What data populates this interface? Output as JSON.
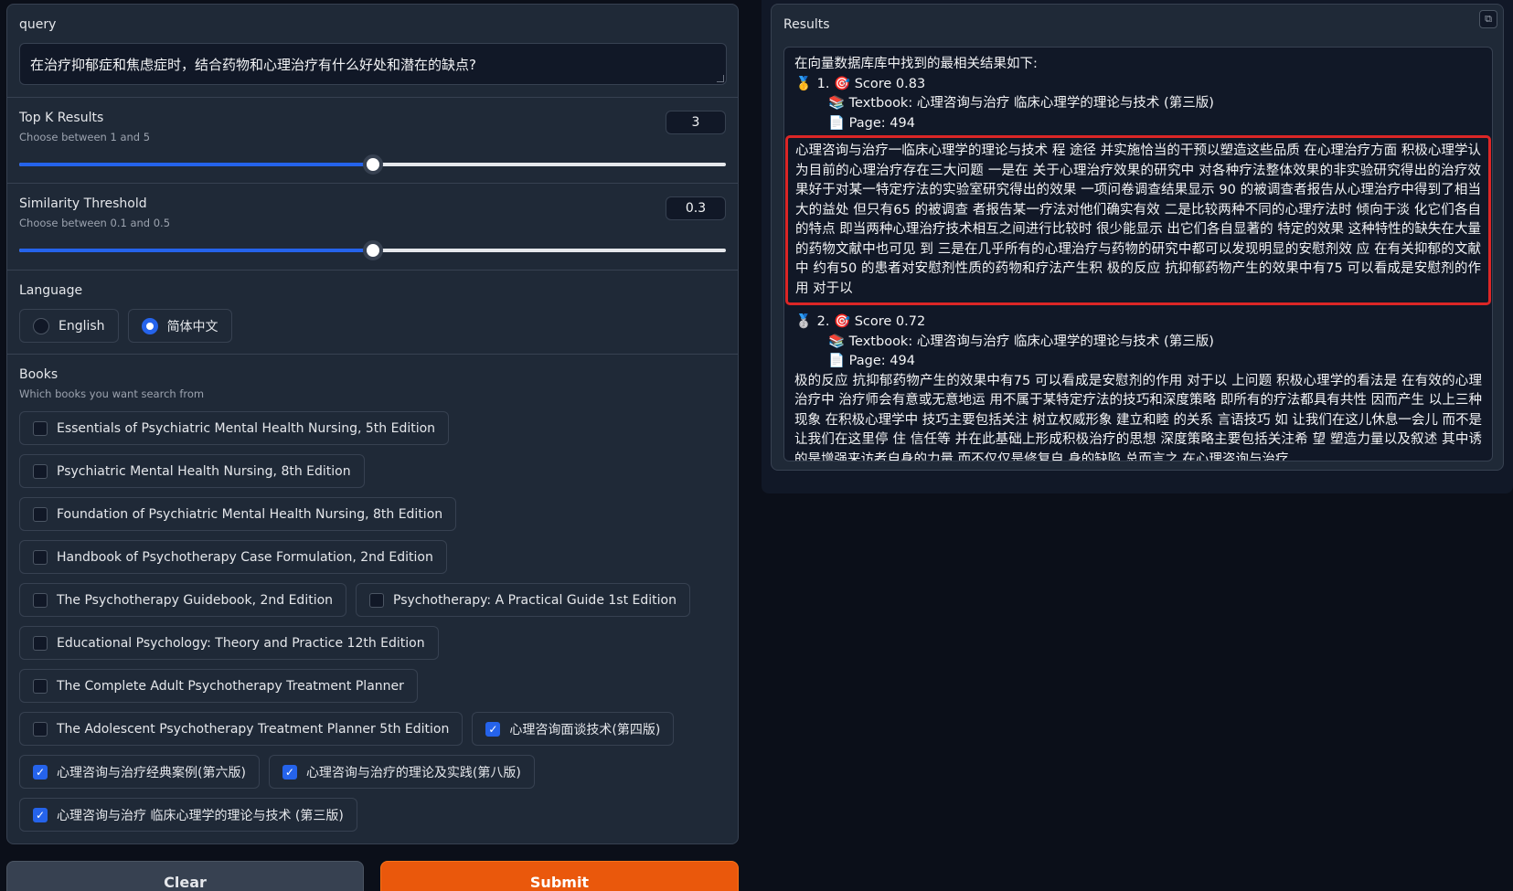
{
  "query": {
    "label": "query",
    "value": "在治疗抑郁症和焦虑症时，结合药物和心理治疗有什么好处和潜在的缺点?"
  },
  "top_k": {
    "label": "Top K Results",
    "info": "Choose between 1 and 5",
    "value": "3",
    "fraction": 0.5
  },
  "similarity": {
    "label": "Similarity Threshold",
    "info": "Choose between 0.1 and 0.5",
    "value": "0.3",
    "fraction": 0.5
  },
  "language": {
    "label": "Language",
    "options": [
      {
        "label": "English",
        "selected": false
      },
      {
        "label": "简体中文",
        "selected": true
      }
    ]
  },
  "books": {
    "label": "Books",
    "info": "Which books you want search from",
    "items": [
      {
        "label": "Essentials of Psychiatric Mental Health Nursing, 5th Edition",
        "checked": false
      },
      {
        "label": "Psychiatric Mental Health Nursing, 8th Edition",
        "checked": false
      },
      {
        "label": "Foundation of Psychiatric Mental Health Nursing, 8th Edition",
        "checked": false
      },
      {
        "label": "Handbook of Psychotherapy Case Formulation, 2nd Edition",
        "checked": false
      },
      {
        "label": "The Psychotherapy Guidebook, 2nd Edition",
        "checked": false
      },
      {
        "label": "Psychotherapy: A Practical Guide 1st Edition",
        "checked": false
      },
      {
        "label": "Educational Psychology: Theory and Practice 12th Edition",
        "checked": false
      },
      {
        "label": "The Complete Adult Psychotherapy Treatment Planner",
        "checked": false
      },
      {
        "label": "The Adolescent Psychotherapy Treatment Planner 5th Edition",
        "checked": false
      },
      {
        "label": "心理咨询面谈技术(第四版)",
        "checked": true
      },
      {
        "label": "心理咨询与治疗经典案例(第六版)",
        "checked": true
      },
      {
        "label": "心理咨询与治疗的理论及实践(第八版)",
        "checked": true
      },
      {
        "label": "心理咨询与治疗 临床心理学的理论与技术 (第三版)",
        "checked": true
      }
    ]
  },
  "buttons": {
    "clear": "Clear",
    "submit": "Submit"
  },
  "results": {
    "label": "Results",
    "intro": "在向量数据库库中找到的最相关结果如下:",
    "items": [
      {
        "medal": "🥇",
        "score_line": "1. 🎯 Score 0.83",
        "textbook": "📚 Textbook: 心理咨询与治疗 临床心理学的理论与技术 (第三版)",
        "page": "📄 Page: 494",
        "text": "心理咨询与治疗一临床心理学的理论与技术 程 途径 并实施恰当的干预以塑造这些品质 在心理治疗方面 积极心理学认为目前的心理治疗存在三大问题 一是在 关于心理治疗效果的研究中 对各种疗法整体效果的非实验研究得出的治疗效 果好于对某一特定疗法的实验室研究得出的效果 一项问卷调查结果显示 90 的被调查者报告从心理治疗中得到了相当大的益处 但只有65 的被调查 者报告某一疗法对他们确实有效 二是比较两种不同的心理疗法时 倾向于淡 化它们各自的特点 即当两种心理治疗技术相互之间进行比较时 很少能显示 出它们各自显著的 特定的效果 这种特性的缺失在大量的药物文献中也可见 到 三是在几乎所有的心理治疗与药物的研究中都可以发现明显的安慰剂效 应 在有关抑郁的文献中 约有50 的患者对安慰剂性质的药物和疗法产生积 极的反应 抗抑郁药物产生的效果中有75 可以看成是安慰剂的作用 对于以"
      },
      {
        "medal": "🥈",
        "score_line": "2. 🎯 Score 0.72",
        "textbook": "📚 Textbook: 心理咨询与治疗 临床心理学的理论与技术 (第三版)",
        "page": "📄 Page: 494",
        "text": "极的反应 抗抑郁药物产生的效果中有75 可以看成是安慰剂的作用 对于以 上问题 积极心理学的看法是 在有效的心理治疗中 治疗师会有意或无意地运 用不属于某特定疗法的技巧和深度策略 即所有的疗法都具有共性 因而产生 以上三种现象 在积极心理学中 技巧主要包括关注 树立权威形象 建立和睦 的关系 言语技巧 如 让我们在这儿休息一会儿 而不是 让我们在这里停 住  信任等 并在此基础上形成积极治疗的思想 深度策略主要包括关注希 望 塑造力量以及叙述 其中诱的是增强来访者自身的力量 而不仅仅是修复自 身的缺陷 总而言之 在心理咨询与治疗"
      }
    ]
  }
}
